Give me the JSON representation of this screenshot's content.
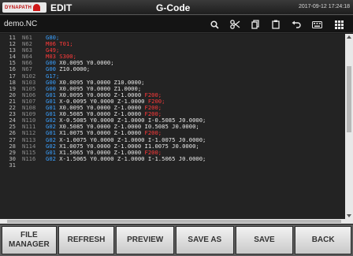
{
  "header": {
    "logo_text": "DYNAPATH",
    "mode": "EDIT",
    "title": "G-Code",
    "datetime": "2017-09-12 17:24:18"
  },
  "file": {
    "name": "demo.NC"
  },
  "toolbar": {
    "icons": [
      "search-icon",
      "cut-icon",
      "copy-icon",
      "paste-icon",
      "undo-icon",
      "keyboard-icon",
      "grid-menu-icon"
    ]
  },
  "code_lines": [
    {
      "ln": "11",
      "nn": "N61",
      "parts": [
        {
          "t": "G80;",
          "c": "g"
        }
      ]
    },
    {
      "ln": "12",
      "nn": "N62",
      "parts": [
        {
          "t": "M06 T01;",
          "c": "r"
        }
      ]
    },
    {
      "ln": "13",
      "nn": "N63",
      "parts": [
        {
          "t": "G49;",
          "c": "r"
        }
      ]
    },
    {
      "ln": "14",
      "nn": "N64",
      "parts": [
        {
          "t": "M03 S300;",
          "c": "r"
        }
      ]
    },
    {
      "ln": "15",
      "nn": "N66",
      "parts": [
        {
          "t": "G00",
          "c": "g"
        },
        {
          "t": " X0.0095 Y0.0000;",
          "c": "p"
        }
      ]
    },
    {
      "ln": "16",
      "nn": "N67",
      "parts": [
        {
          "t": "G00",
          "c": "g"
        },
        {
          "t": " Z10.0000;",
          "c": "p"
        }
      ]
    },
    {
      "ln": "17",
      "nn": "N102",
      "parts": [
        {
          "t": "G17;",
          "c": "g"
        }
      ]
    },
    {
      "ln": "18",
      "nn": "N103",
      "parts": [
        {
          "t": "G00",
          "c": "g"
        },
        {
          "t": " X0.0095 Y0.0000 Z10.0000;",
          "c": "p"
        }
      ]
    },
    {
      "ln": "19",
      "nn": "N105",
      "parts": [
        {
          "t": "G00",
          "c": "g"
        },
        {
          "t": " X0.0095 Y0.0000 Z1.0000;",
          "c": "p"
        }
      ]
    },
    {
      "ln": "20",
      "nn": "N106",
      "parts": [
        {
          "t": "G01",
          "c": "g"
        },
        {
          "t": " X0.0095 Y0.0000 Z-1.0000 ",
          "c": "p"
        },
        {
          "t": "F200;",
          "c": "r"
        }
      ]
    },
    {
      "ln": "21",
      "nn": "N107",
      "parts": [
        {
          "t": "G01",
          "c": "g"
        },
        {
          "t": " X-0.0095 Y0.0000 Z-1.0000 ",
          "c": "p"
        },
        {
          "t": "F200;",
          "c": "r"
        }
      ]
    },
    {
      "ln": "22",
      "nn": "N108",
      "parts": [
        {
          "t": "G01",
          "c": "g"
        },
        {
          "t": " X0.0095 Y0.0000 Z-1.0000 ",
          "c": "p"
        },
        {
          "t": "F200;",
          "c": "r"
        }
      ]
    },
    {
      "ln": "23",
      "nn": "N109",
      "parts": [
        {
          "t": "G01",
          "c": "g"
        },
        {
          "t": " X0.5085 Y0.0000 Z-1.0000 ",
          "c": "p"
        },
        {
          "t": "F200;",
          "c": "r"
        }
      ]
    },
    {
      "ln": "24",
      "nn": "N110",
      "parts": [
        {
          "t": "G02",
          "c": "g"
        },
        {
          "t": " X-0.5085 Y0.0000 Z-1.0000 I-0.5085 J0.0000;",
          "c": "p"
        }
      ]
    },
    {
      "ln": "25",
      "nn": "N111",
      "parts": [
        {
          "t": "G02",
          "c": "g"
        },
        {
          "t": " X0.5085 Y0.0000 Z-1.0000 I0.5085 J0.0000;",
          "c": "p"
        }
      ]
    },
    {
      "ln": "26",
      "nn": "N112",
      "parts": [
        {
          "t": "G01",
          "c": "g"
        },
        {
          "t": " X1.0075 Y0.0000 Z-1.0000 ",
          "c": "p"
        },
        {
          "t": "F200;",
          "c": "r"
        }
      ]
    },
    {
      "ln": "27",
      "nn": "N113",
      "parts": [
        {
          "t": "G02",
          "c": "g"
        },
        {
          "t": " X-1.0075 Y0.0000 Z-1.0000 I-1.0075 J0.0000;",
          "c": "p"
        }
      ]
    },
    {
      "ln": "28",
      "nn": "N114",
      "parts": [
        {
          "t": "G02",
          "c": "g"
        },
        {
          "t": " X1.0075 Y0.0000 Z-1.0000 I1.0075 J0.0000;",
          "c": "p"
        }
      ]
    },
    {
      "ln": "29",
      "nn": "N115",
      "parts": [
        {
          "t": "G01",
          "c": "g"
        },
        {
          "t": " X1.5065 Y0.0000 Z-1.0000 ",
          "c": "p"
        },
        {
          "t": "F200;",
          "c": "r"
        }
      ]
    },
    {
      "ln": "30",
      "nn": "N116",
      "parts": [
        {
          "t": "G02",
          "c": "g"
        },
        {
          "t": " X-1.5065 Y0.0000 Z-1.0000 I-1.5065 J0.0000;",
          "c": "p"
        }
      ]
    },
    {
      "ln": "31",
      "nn": "",
      "parts": []
    }
  ],
  "buttons": {
    "file_manager": "FILE\nMANAGER",
    "refresh": "REFRESH",
    "preview": "PREVIEW",
    "save_as": "SAVE AS",
    "save": "SAVE",
    "back": "BACK"
  },
  "colors": {
    "gcode": "#3aa0ff",
    "mcode": "#ff3a3a",
    "background": "#232323"
  }
}
